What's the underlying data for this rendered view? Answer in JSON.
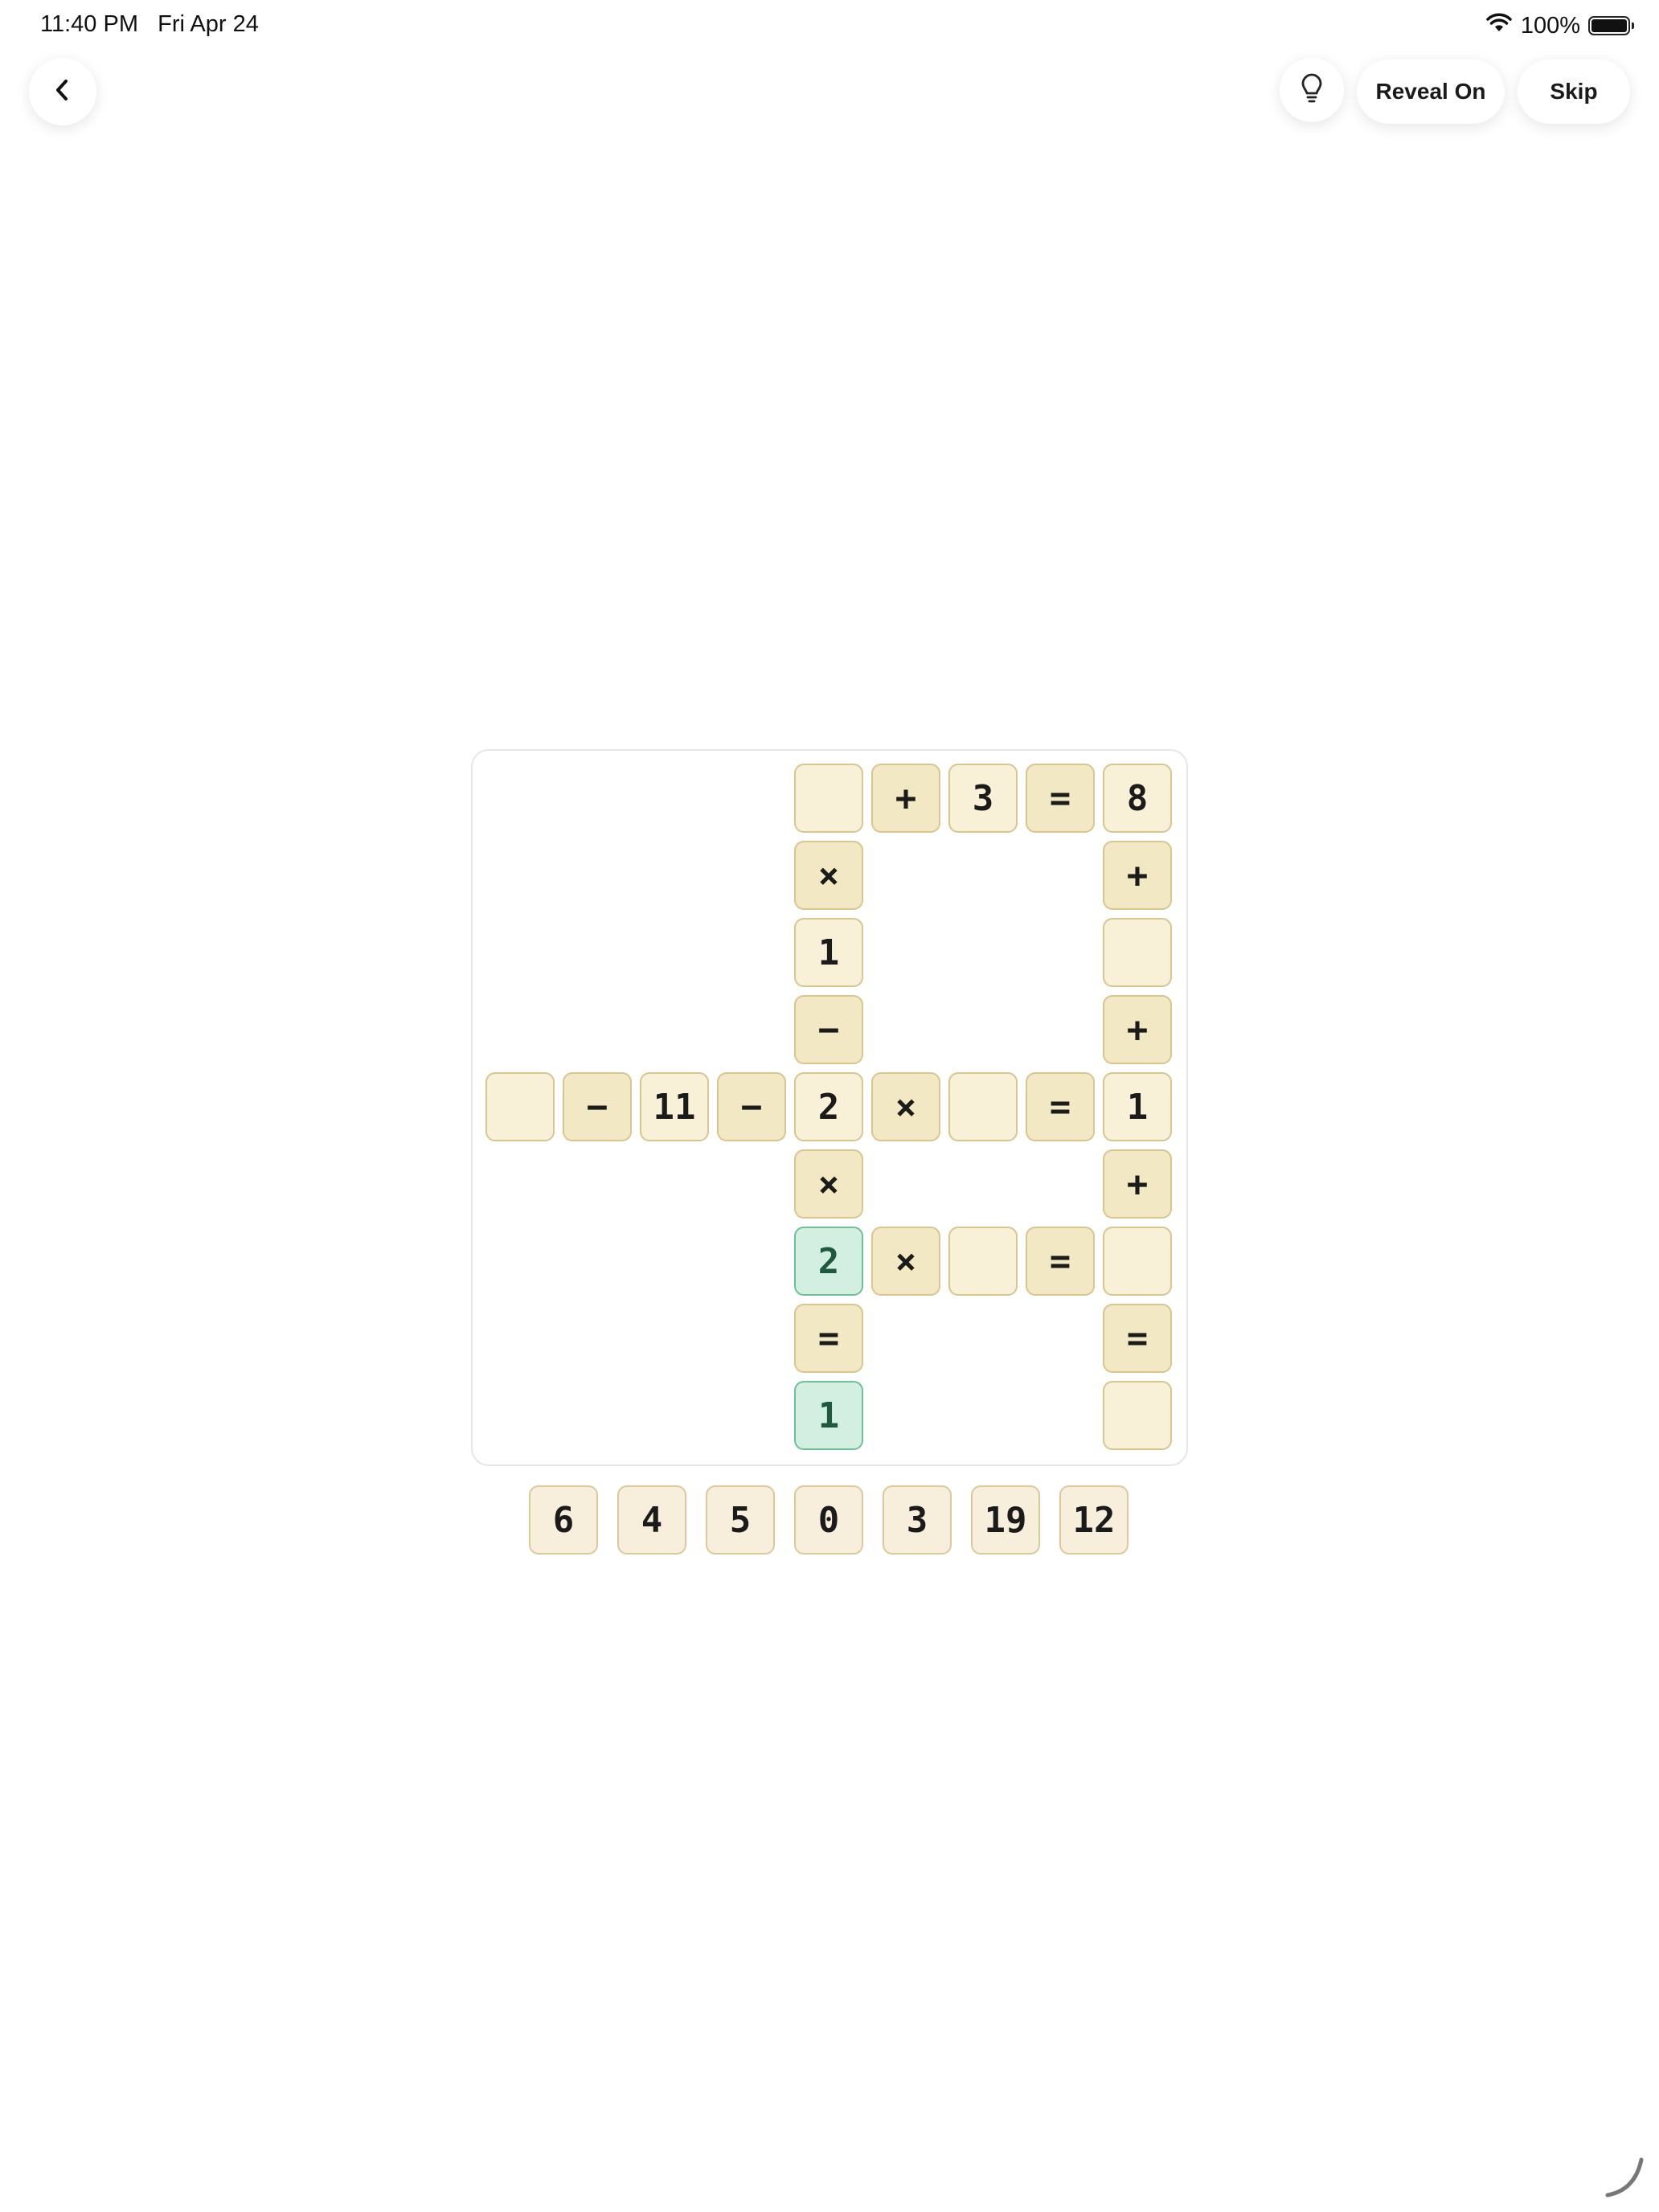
{
  "status_bar": {
    "time": "11:40 PM",
    "date": "Fri Apr 24",
    "battery": "100%",
    "battery_level": 1.0,
    "wifi_icon": "wifi-icon",
    "battery_icon": "battery-icon"
  },
  "toolbar": {
    "back_icon": "chevron-left-icon",
    "hint_icon": "lightbulb-icon",
    "reveal_label": "Reveal On",
    "skip_label": "Skip"
  },
  "board": {
    "rows": 9,
    "cols": 9,
    "cells": [
      {
        "r": 0,
        "c": 4,
        "t": "empty",
        "v": ""
      },
      {
        "r": 0,
        "c": 5,
        "t": "op",
        "v": "+"
      },
      {
        "r": 0,
        "c": 6,
        "t": "num",
        "v": "3"
      },
      {
        "r": 0,
        "c": 7,
        "t": "op",
        "v": "="
      },
      {
        "r": 0,
        "c": 8,
        "t": "num",
        "v": "8"
      },
      {
        "r": 1,
        "c": 4,
        "t": "op",
        "v": "×"
      },
      {
        "r": 1,
        "c": 8,
        "t": "op",
        "v": "+"
      },
      {
        "r": 2,
        "c": 4,
        "t": "num",
        "v": "1"
      },
      {
        "r": 2,
        "c": 8,
        "t": "empty",
        "v": ""
      },
      {
        "r": 3,
        "c": 4,
        "t": "op",
        "v": "−"
      },
      {
        "r": 3,
        "c": 8,
        "t": "op",
        "v": "+"
      },
      {
        "r": 4,
        "c": 0,
        "t": "empty",
        "v": ""
      },
      {
        "r": 4,
        "c": 1,
        "t": "op",
        "v": "−"
      },
      {
        "r": 4,
        "c": 2,
        "t": "num",
        "v": "11"
      },
      {
        "r": 4,
        "c": 3,
        "t": "op",
        "v": "−"
      },
      {
        "r": 4,
        "c": 4,
        "t": "num",
        "v": "2"
      },
      {
        "r": 4,
        "c": 5,
        "t": "op",
        "v": "×"
      },
      {
        "r": 4,
        "c": 6,
        "t": "empty",
        "v": ""
      },
      {
        "r": 4,
        "c": 7,
        "t": "op",
        "v": "="
      },
      {
        "r": 4,
        "c": 8,
        "t": "num",
        "v": "1"
      },
      {
        "r": 5,
        "c": 4,
        "t": "op",
        "v": "×"
      },
      {
        "r": 5,
        "c": 8,
        "t": "op",
        "v": "+"
      },
      {
        "r": 6,
        "c": 4,
        "t": "locked",
        "v": "2"
      },
      {
        "r": 6,
        "c": 5,
        "t": "op",
        "v": "×"
      },
      {
        "r": 6,
        "c": 6,
        "t": "empty",
        "v": ""
      },
      {
        "r": 6,
        "c": 7,
        "t": "op",
        "v": "="
      },
      {
        "r": 6,
        "c": 8,
        "t": "empty",
        "v": ""
      },
      {
        "r": 7,
        "c": 4,
        "t": "op",
        "v": "="
      },
      {
        "r": 7,
        "c": 8,
        "t": "op",
        "v": "="
      },
      {
        "r": 8,
        "c": 4,
        "t": "locked",
        "v": "1"
      },
      {
        "r": 8,
        "c": 8,
        "t": "empty",
        "v": ""
      }
    ]
  },
  "tray": [
    "6",
    "4",
    "5",
    "0",
    "3",
    "19",
    "12"
  ]
}
